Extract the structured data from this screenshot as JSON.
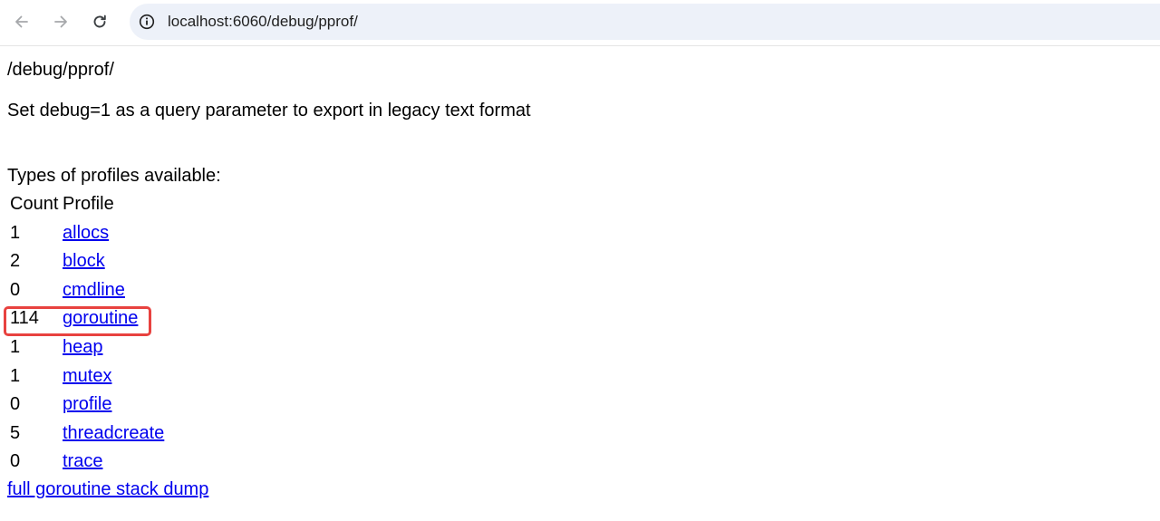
{
  "browser": {
    "url": "localhost:6060/debug/pprof/",
    "icons": {
      "back": "arrow-left-icon",
      "forward": "arrow-right-icon",
      "reload": "reload-icon",
      "site_info": "info-circle-icon"
    }
  },
  "page": {
    "title": "/debug/pprof/",
    "hint": "Set debug=1 as a query parameter to export in legacy text format",
    "types_label": "Types of profiles available:",
    "table": {
      "headers": {
        "count": "Count",
        "profile": "Profile"
      },
      "rows": [
        {
          "count": "1",
          "profile": "allocs"
        },
        {
          "count": "2",
          "profile": "block"
        },
        {
          "count": "0",
          "profile": "cmdline"
        },
        {
          "count": "114",
          "profile": "goroutine"
        },
        {
          "count": "1",
          "profile": "heap"
        },
        {
          "count": "1",
          "profile": "mutex"
        },
        {
          "count": "0",
          "profile": "profile"
        },
        {
          "count": "5",
          "profile": "threadcreate"
        },
        {
          "count": "0",
          "profile": "trace"
        }
      ]
    },
    "full_dump_link": "full goroutine stack dump"
  },
  "colors": {
    "link": "#0000ee",
    "highlight": "#e8423f",
    "omnibox": "#edf1f9"
  }
}
